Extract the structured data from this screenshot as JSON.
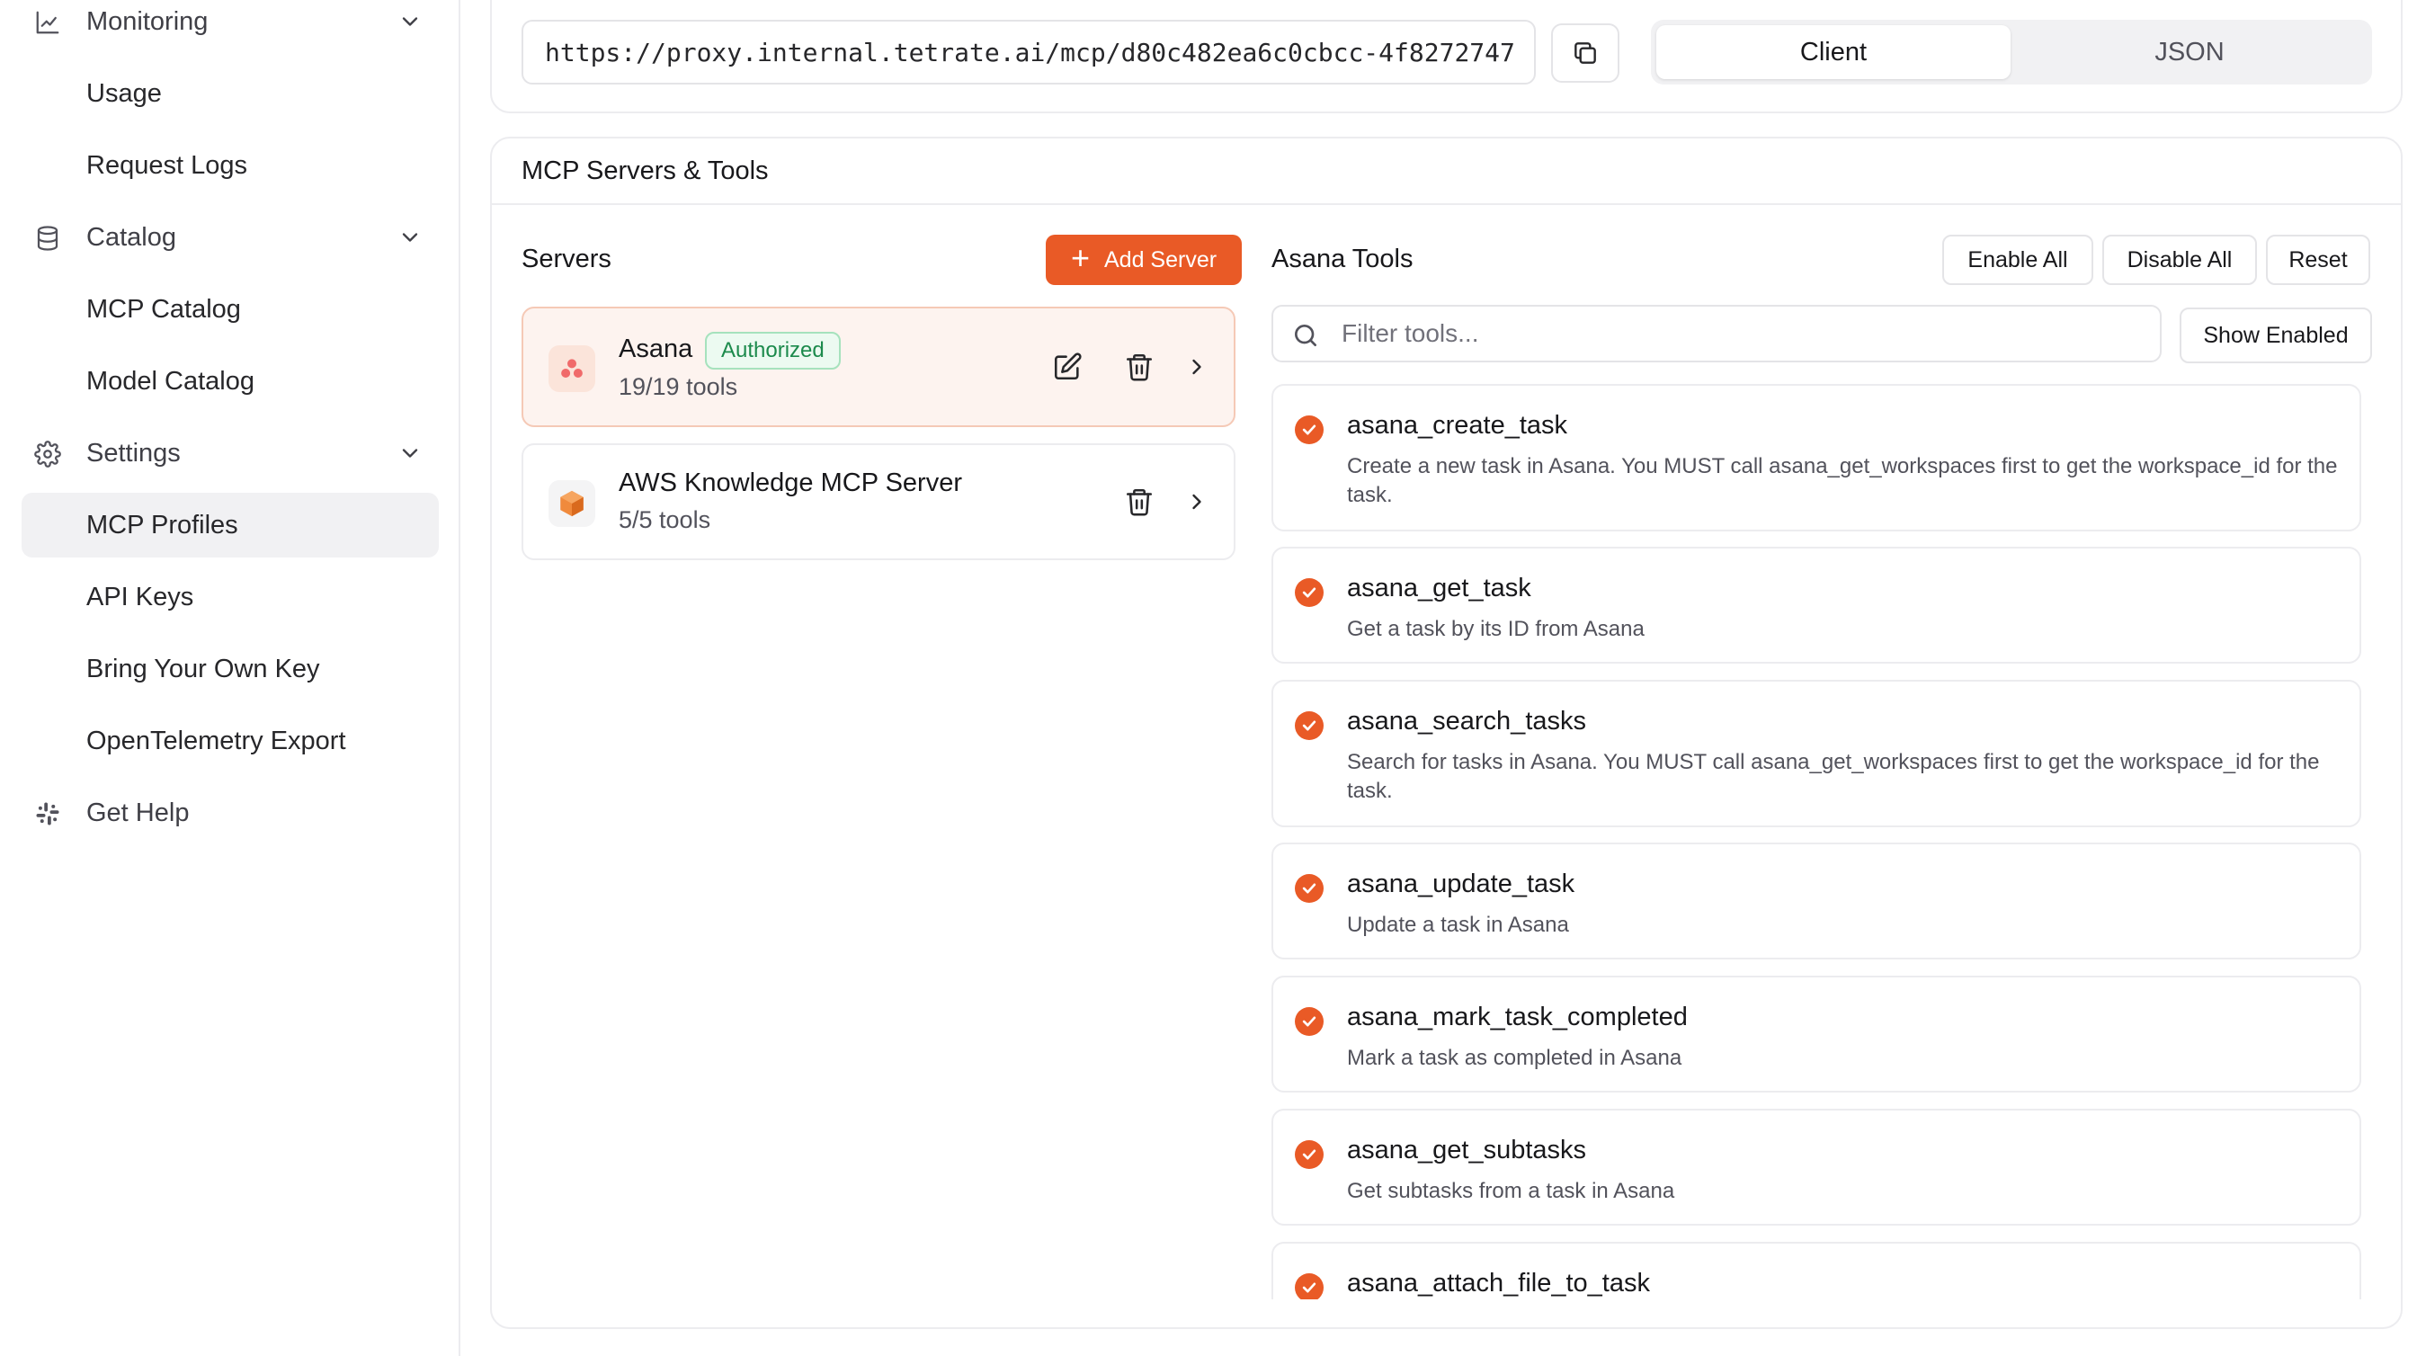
{
  "sidebar": {
    "items": [
      {
        "label": "Monitoring",
        "icon": "chart-icon",
        "expandable": true
      },
      {
        "label": "Usage"
      },
      {
        "label": "Request Logs"
      },
      {
        "label": "Catalog",
        "icon": "database-icon",
        "expandable": true
      },
      {
        "label": "MCP Catalog"
      },
      {
        "label": "Model Catalog"
      },
      {
        "label": "Settings",
        "icon": "gear-icon",
        "expandable": true
      },
      {
        "label": "MCP Profiles",
        "active": true
      },
      {
        "label": "API Keys"
      },
      {
        "label": "Bring Your Own Key"
      },
      {
        "label": "OpenTelemetry Export"
      },
      {
        "label": "Get Help",
        "icon": "slack-icon"
      }
    ]
  },
  "endpoint": {
    "url": "https://proxy.internal.tetrate.ai/mcp/d80c482ea6c0cbcc-4f8272747",
    "copy_icon": "copy-icon",
    "tabs": [
      {
        "label": "Client",
        "selected": true
      },
      {
        "label": "JSON",
        "selected": false
      }
    ]
  },
  "section": {
    "title": "MCP Servers & Tools"
  },
  "servers": {
    "title": "Servers",
    "add_label": "Add Server",
    "items": [
      {
        "name": "Asana",
        "badge": "Authorized",
        "count": "19/19 tools",
        "selected": true,
        "icon": "asana-logo"
      },
      {
        "name": "AWS Knowledge MCP Server",
        "count": "5/5 tools",
        "selected": false,
        "icon": "aws-cube-logo"
      }
    ]
  },
  "tools": {
    "title": "Asana Tools",
    "enable_all": "Enable All",
    "disable_all": "Disable All",
    "reset": "Reset",
    "filter_placeholder": "Filter tools...",
    "show_enabled": "Show Enabled",
    "accent": "#e95a26",
    "items": [
      {
        "name": "asana_create_task",
        "desc": "Create a new task in Asana. You MUST call asana_get_workspaces first to get the workspace_id for the task.",
        "enabled": true
      },
      {
        "name": "asana_get_task",
        "desc": "Get a task by its ID from Asana",
        "enabled": true
      },
      {
        "name": "asana_search_tasks",
        "desc": "Search for tasks in Asana. You MUST call asana_get_workspaces first to get the workspace_id for the task.",
        "enabled": true
      },
      {
        "name": "asana_update_task",
        "desc": "Update a task in Asana",
        "enabled": true
      },
      {
        "name": "asana_mark_task_completed",
        "desc": "Mark a task as completed in Asana",
        "enabled": true
      },
      {
        "name": "asana_get_subtasks",
        "desc": "Get subtasks from a task in Asana",
        "enabled": true
      },
      {
        "name": "asana_attach_file_to_task",
        "desc": "",
        "enabled": true
      }
    ]
  }
}
